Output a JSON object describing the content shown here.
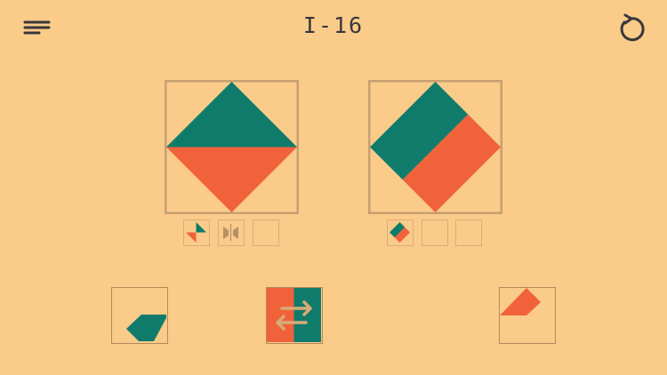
{
  "header": {
    "level_label": "I-16",
    "menu_icon": "hamburger-menu-icon",
    "restart_icon": "restart-arrow-icon"
  },
  "colors": {
    "background": "#fbcb8a",
    "teal": "#0f7b6b",
    "orange": "#f1623a",
    "frame": "#c7a071",
    "slot_border": "#d9ad7b",
    "icon": "#39373a",
    "arrows": "#d8ab76"
  },
  "puzzles": [
    {
      "name": "puzzle-left",
      "slots_filled": 2,
      "slots_total": 3
    },
    {
      "name": "puzzle-right",
      "slots_filled": 1,
      "slots_total": 3
    }
  ],
  "tiles": [
    {
      "name": "tile-teal-corner",
      "icon": "teal-corner-shape-icon"
    },
    {
      "name": "tile-swap",
      "icon": "swap-arrows-icon"
    },
    {
      "name": "tile-orange-corner",
      "icon": "orange-corner-shape-icon"
    }
  ]
}
